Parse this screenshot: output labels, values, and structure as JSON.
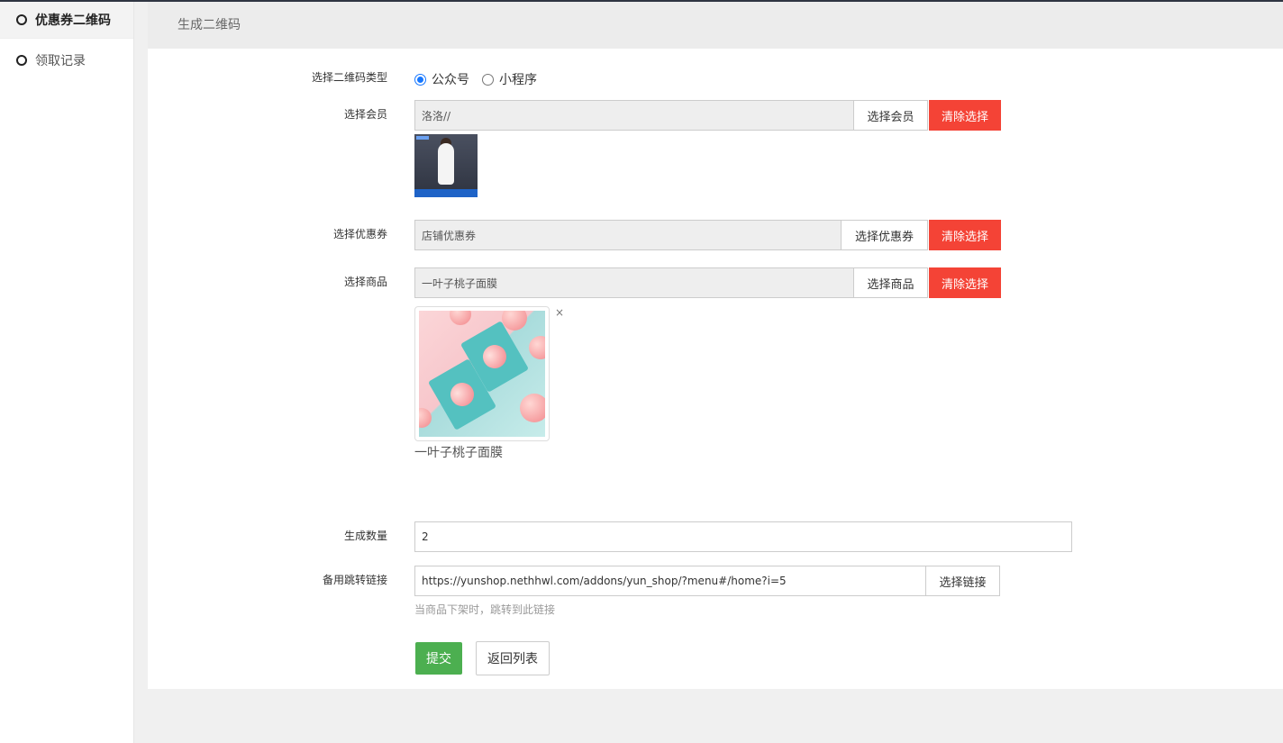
{
  "sidebar": {
    "items": [
      {
        "label": "优惠券二维码",
        "active": true
      },
      {
        "label": "领取记录",
        "active": false
      }
    ]
  },
  "header": {
    "title": "生成二维码"
  },
  "form": {
    "qr_type": {
      "label": "选择二维码类型",
      "options": [
        {
          "label": "公众号",
          "checked": true
        },
        {
          "label": "小程序",
          "checked": false
        }
      ]
    },
    "member": {
      "label": "选择会员",
      "value": "洛洛//",
      "select_button": "选择会员",
      "clear_button": "清除选择"
    },
    "coupon": {
      "label": "选择优惠券",
      "value": "店铺优惠券",
      "select_button": "选择优惠券",
      "clear_button": "清除选择"
    },
    "goods": {
      "label": "选择商品",
      "value": "一叶子桃子面膜",
      "select_button": "选择商品",
      "clear_button": "清除选择",
      "close_symbol": "×",
      "item_name": "一叶子桃子面膜"
    },
    "quantity": {
      "label": "生成数量",
      "value": "2"
    },
    "backup_link": {
      "label": "备用跳转链接",
      "value": "https://yunshop.nethhwl.com/addons/yun_shop/?menu#/home?i=5",
      "select_button": "选择链接",
      "help": "当商品下架时，跳转到此链接"
    },
    "submit_button": "提交",
    "back_button": "返回列表"
  },
  "colors": {
    "danger": "#f44336",
    "success": "#4caf50",
    "radio": "#1677ff"
  }
}
